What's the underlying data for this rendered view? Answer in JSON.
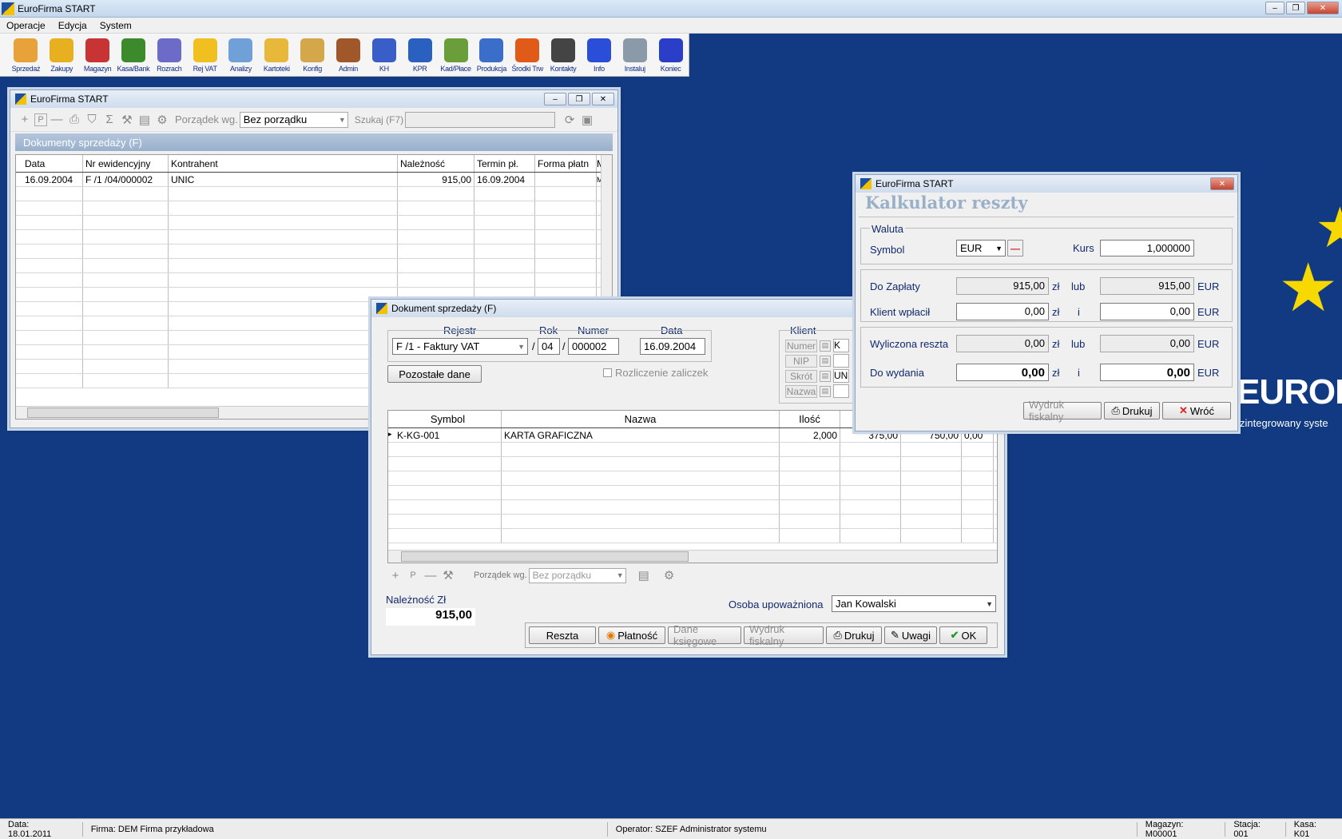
{
  "app": {
    "title": "EuroFirma START"
  },
  "menu": [
    "Operacje",
    "Edycja",
    "System"
  ],
  "toolbar": [
    {
      "label": "Sprzedaż",
      "icon": "handshake-icon",
      "color": "#e8a23a"
    },
    {
      "label": "Zakupy",
      "icon": "cart-icon",
      "color": "#e6b020"
    },
    {
      "label": "Magazyn",
      "icon": "runner-icon",
      "color": "#c83434"
    },
    {
      "label": "Kasa/Bank",
      "icon": "money-bag-icon",
      "color": "#3d8a2d"
    },
    {
      "label": "Rozrach",
      "icon": "calculator-icon",
      "color": "#6c6cc8"
    },
    {
      "label": "Rej VAT",
      "icon": "folder-vat-icon",
      "color": "#f0c020"
    },
    {
      "label": "Analizy",
      "icon": "chart-icon",
      "color": "#6fa0d8"
    },
    {
      "label": "Kartoteki",
      "icon": "folders-icon",
      "color": "#e8b83a"
    },
    {
      "label": "Konfig",
      "icon": "hammer-icon",
      "color": "#d4a74a"
    },
    {
      "label": "Admin",
      "icon": "stamp-icon",
      "color": "#a0582a"
    },
    {
      "label": "KH",
      "icon": "ma-wn-icon",
      "color": "#3a5ec8"
    },
    {
      "label": "KPR",
      "icon": "ledger-icon",
      "color": "#2a60c0"
    },
    {
      "label": "Kad/Płace",
      "icon": "pen-icon",
      "color": "#6a9e3a"
    },
    {
      "label": "Produkcja",
      "icon": "workers-icon",
      "color": "#3a6ec8"
    },
    {
      "label": "Środki Trw",
      "icon": "truck-icon",
      "color": "#e05a1a"
    },
    {
      "label": "Kontakty",
      "icon": "phone-person-icon",
      "color": "#444"
    },
    {
      "label": "Info",
      "icon": "info-icon",
      "color": "#2a4ed8"
    },
    {
      "label": "Instaluj",
      "icon": "disc-icon",
      "color": "#8a9aa8"
    },
    {
      "label": "Koniec",
      "icon": "exit-icon",
      "color": "#2a3ec8"
    }
  ],
  "listWindow": {
    "title": "EuroFirma START",
    "orderLabel": "Porządek wg.",
    "orderValue": "Bez porządku",
    "searchLabel": "Szukaj (F7)",
    "searchValue": "",
    "header": "Dokumenty sprzedaży (F)",
    "columns": [
      "Data",
      "Nr ewidencyjny",
      "Kontrahent",
      "Należność",
      "Termin pł.",
      "Forma płatn",
      "M"
    ],
    "rows": [
      [
        "16.09.2004",
        "F /1  /04/000002",
        "UNIC",
        "915,00",
        "16.09.2004",
        "",
        "M"
      ]
    ]
  },
  "docWindow": {
    "title": "Dokument sprzedaży (F)",
    "rejestrLabel": "Rejestr",
    "rokLabel": "Rok",
    "numerLabel": "Numer",
    "dataLabel": "Data",
    "rejestrValue": "F /1  - Faktury VAT",
    "rokValue": "04",
    "numerValue": "000002",
    "dataValue": "16.09.2004",
    "slash": "/",
    "klientLabel": "Klient",
    "klientFields": [
      "Numer",
      "NIP",
      "Skrót",
      "Nazwa"
    ],
    "klientValues": [
      "K",
      "",
      "UN",
      ""
    ],
    "pozostaleButton": "Pozostałe dane",
    "rozliczenieLabel": "Rozliczenie zaliczek",
    "columns": [
      "Symbol",
      "Nazwa",
      "Ilość",
      "",
      "",
      ""
    ],
    "items": [
      [
        "K-KG-001",
        "KARTA GRAFICZNA",
        "2,000",
        "375,00",
        "750,00",
        "0,00"
      ]
    ],
    "orderLabel": "Porządek wg.",
    "orderValue": "Bez porządku",
    "naleznoscLabel": "Należność Zł",
    "naleznoscValue": "915,00",
    "osobaLabel": "Osoba upoważniona",
    "osobaValue": "Jan Kowalski",
    "buttons": {
      "reszta": "Reszta",
      "platnosc": "Płatność",
      "daneKsiegowe": "Dane księgowe",
      "wydrukFiskalny": "Wydruk fiskalny",
      "drukuj": "Drukuj",
      "uwagi": "Uwagi",
      "ok": "OK"
    }
  },
  "calcWindow": {
    "title": "EuroFirma START",
    "heading": "Kalkulator reszty",
    "walutaLabel": "Waluta",
    "symbolLabel": "Symbol",
    "symbolValue": "EUR",
    "kursLabel": "Kurs",
    "kursValue": "1,000000",
    "rows": [
      {
        "label": "Do Zapłaty",
        "pln": "915,00",
        "mid": "lub",
        "eur": "915,00",
        "bold": false
      },
      {
        "label": "Klient wpłacił",
        "pln": "0,00",
        "mid": "i",
        "eur": "0,00",
        "bold": false
      },
      {
        "label": "Wyliczona reszta",
        "pln": "0,00",
        "mid": "lub",
        "eur": "0,00",
        "bold": false
      },
      {
        "label": "Do wydania",
        "pln": "0,00",
        "mid": "i",
        "eur": "0,00",
        "bold": true
      }
    ],
    "plnUnit": "zł",
    "eurUnit": "EUR",
    "buttons": {
      "wydrukFiskalny": "Wydruk fiskalny",
      "drukuj": "Drukuj",
      "wroc": "Wróć"
    }
  },
  "background": {
    "brand": "EUROF",
    "tagline": "zintegrowany syste",
    "bgColor": "#113a82"
  },
  "status": {
    "data": "Data: 18.01.2011",
    "firma": "Firma: DEM Firma przykładowa",
    "operator": "Operator: SZEF Administrator systemu",
    "magazyn": "Magazyn: M00001",
    "stacja": "Stacja: 001",
    "kasa": "Kasa: K01"
  }
}
